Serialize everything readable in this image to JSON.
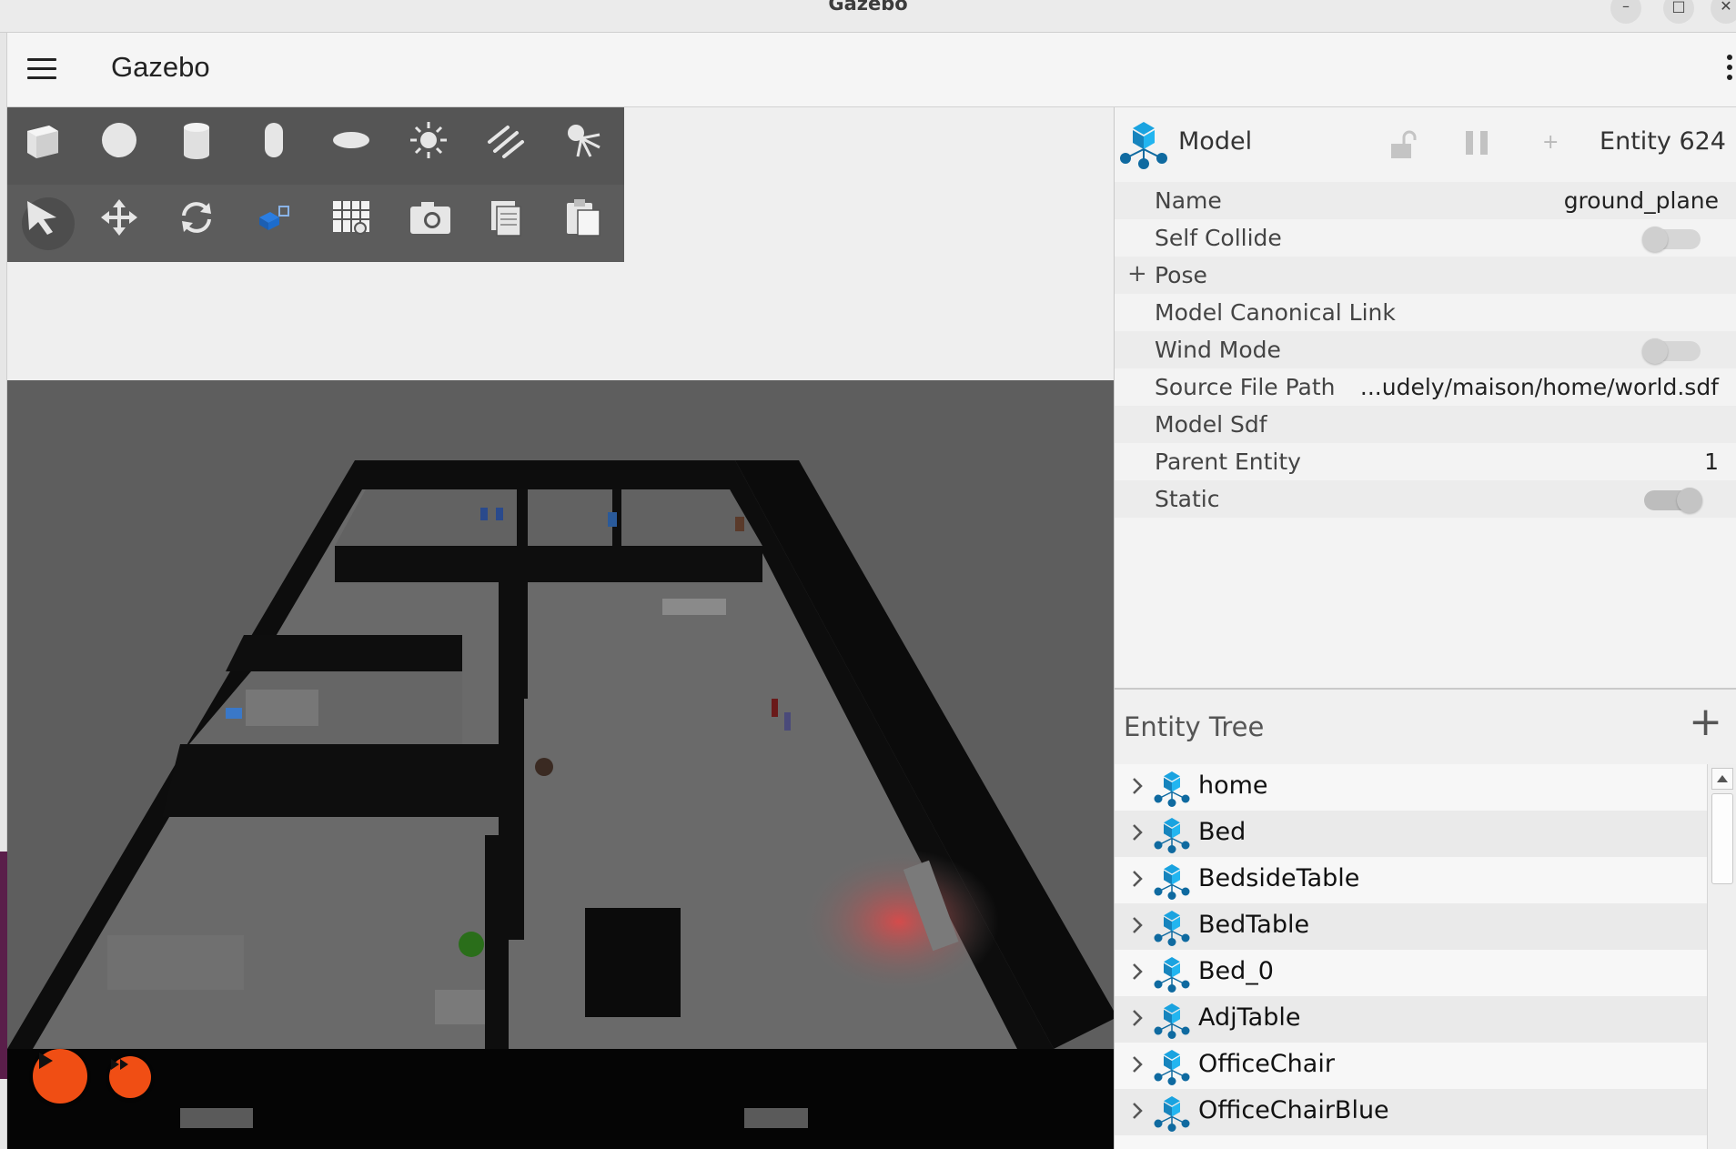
{
  "window": {
    "title": "Gazebo",
    "minimize_icon": "–",
    "maximize_icon": "□",
    "close_icon": "✕"
  },
  "header": {
    "app_title": "Gazebo",
    "menu_icon": "hamburger-menu-icon",
    "overflow_icon": "kebab-menu-icon"
  },
  "toolbar": {
    "shapes": [
      {
        "name": "box-icon"
      },
      {
        "name": "sphere-icon"
      },
      {
        "name": "cylinder-icon"
      },
      {
        "name": "capsule-icon"
      },
      {
        "name": "ellipsoid-icon"
      },
      {
        "name": "point-light-icon"
      },
      {
        "name": "directional-light-icon"
      },
      {
        "name": "spot-light-icon"
      }
    ],
    "tools": [
      {
        "name": "select-icon",
        "active": true
      },
      {
        "name": "translate-icon"
      },
      {
        "name": "rotate-icon"
      },
      {
        "name": "transform-control-icon"
      },
      {
        "name": "grid-snap-icon"
      },
      {
        "name": "screenshot-camera-icon"
      },
      {
        "name": "copy-icon"
      },
      {
        "name": "paste-icon"
      }
    ]
  },
  "playback": {
    "play_icon": "play-icon",
    "step_icon": "fast-forward-icon",
    "accent": "#f04e14"
  },
  "component_inspector": {
    "type_label": "Model",
    "entity_label": "Entity 624",
    "lock_icon": "unlock-icon",
    "pause_icon": "pause-icon",
    "add_icon": "+",
    "properties": [
      {
        "label": "Name",
        "value": "ground_plane"
      },
      {
        "label": "Self Collide",
        "toggle": "off"
      },
      {
        "label": "Pose",
        "expandable": true,
        "expand_symbol": "+"
      },
      {
        "label": "Model Canonical Link",
        "value": ""
      },
      {
        "label": "Wind Mode",
        "toggle": "off"
      },
      {
        "label": "Source File Path",
        "value": "...udely/maison/home/world.sdf"
      },
      {
        "label": "Model Sdf",
        "value": ""
      },
      {
        "label": "Parent Entity",
        "value": "1"
      },
      {
        "label": "Static",
        "toggle": "on"
      }
    ]
  },
  "entity_tree": {
    "title": "Entity Tree",
    "add_icon": "+",
    "items": [
      {
        "label": "home"
      },
      {
        "label": "Bed"
      },
      {
        "label": "BedsideTable"
      },
      {
        "label": "BedTable"
      },
      {
        "label": "Bed_0"
      },
      {
        "label": "AdjTable"
      },
      {
        "label": "OfficeChair"
      },
      {
        "label": "OfficeChairBlue"
      }
    ]
  },
  "colors": {
    "accent_orange": "#f04e14",
    "model_icon_blue": "#1aa3e0",
    "toolbar_bg": "#555555"
  }
}
